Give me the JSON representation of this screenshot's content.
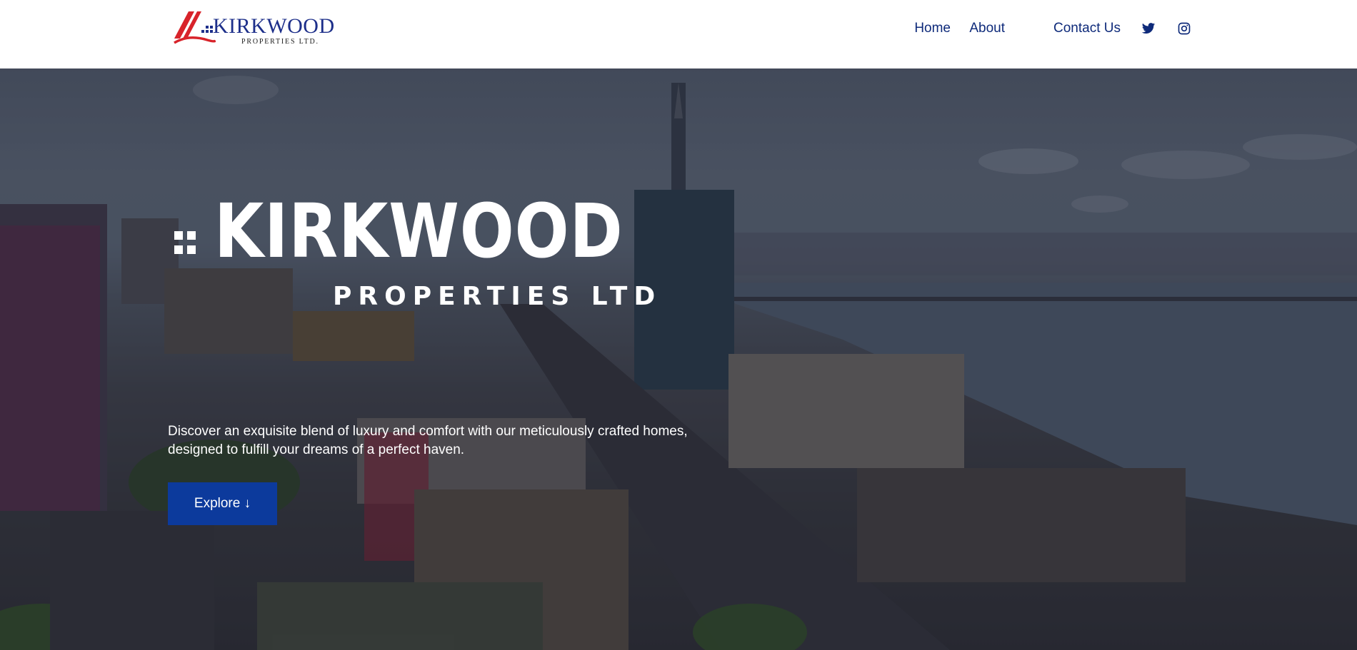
{
  "brand": {
    "name": "KIRKWOOD",
    "subtitle": "PROPERTIES LTD.",
    "colors": {
      "primary": "#1d2f8a",
      "accent": "#d8232a"
    }
  },
  "nav": {
    "items": [
      {
        "label": "Home"
      },
      {
        "label": "About"
      },
      {
        "label": "Contact Us"
      }
    ],
    "social": [
      {
        "icon": "twitter-icon"
      },
      {
        "icon": "instagram-icon"
      }
    ],
    "color": "#0e2a7a"
  },
  "hero": {
    "title": "KIRKWOOD",
    "subtitle": "PROPERTIES LTD",
    "description": "Discover an exquisite blend of luxury and comfort with our meticulously crafted homes, designed to fulfill your dreams of a perfect haven.",
    "cta_label": "Explore ↓",
    "cta_color": "#0c3a9c"
  }
}
